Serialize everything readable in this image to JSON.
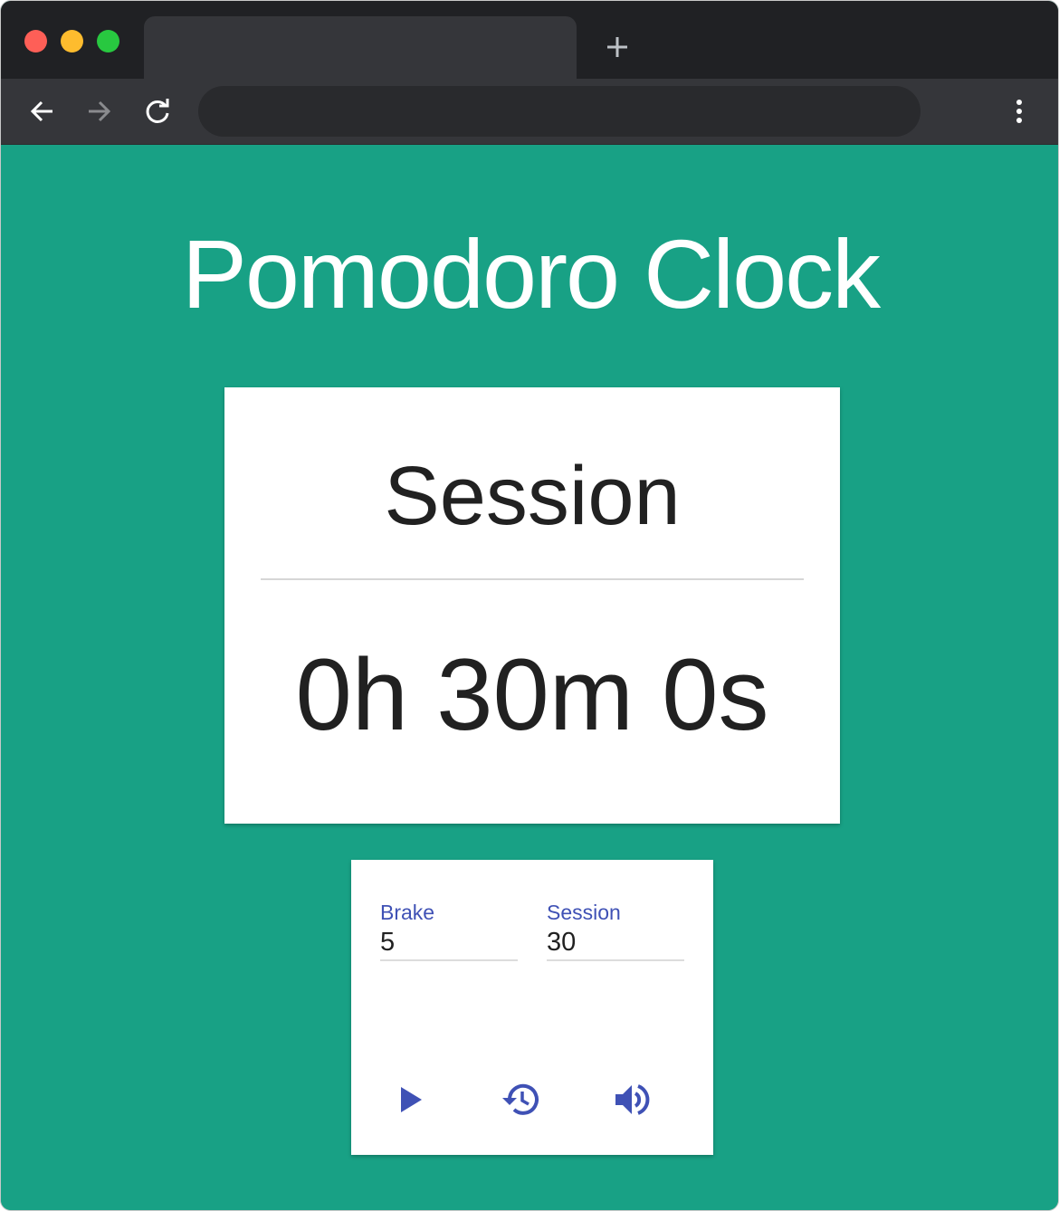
{
  "browser": {
    "icons": {
      "new_tab": "plus-icon",
      "back": "arrow-left-icon",
      "forward": "arrow-right-icon",
      "reload": "reload-icon",
      "menu": "more-vertical-icon"
    }
  },
  "app": {
    "title": "Pomodoro Clock",
    "mode": "Session",
    "time_display": "0h 30m 0s",
    "settings": {
      "brake_label": "Brake",
      "brake_value": "5",
      "session_label": "Session",
      "session_value": "30"
    },
    "controls": {
      "play_icon": "play-icon",
      "reset_icon": "history-icon",
      "sound_icon": "volume-icon"
    },
    "colors": {
      "background": "#18a185",
      "accent": "#3f51b5",
      "card": "#ffffff",
      "text": "#212121"
    }
  }
}
